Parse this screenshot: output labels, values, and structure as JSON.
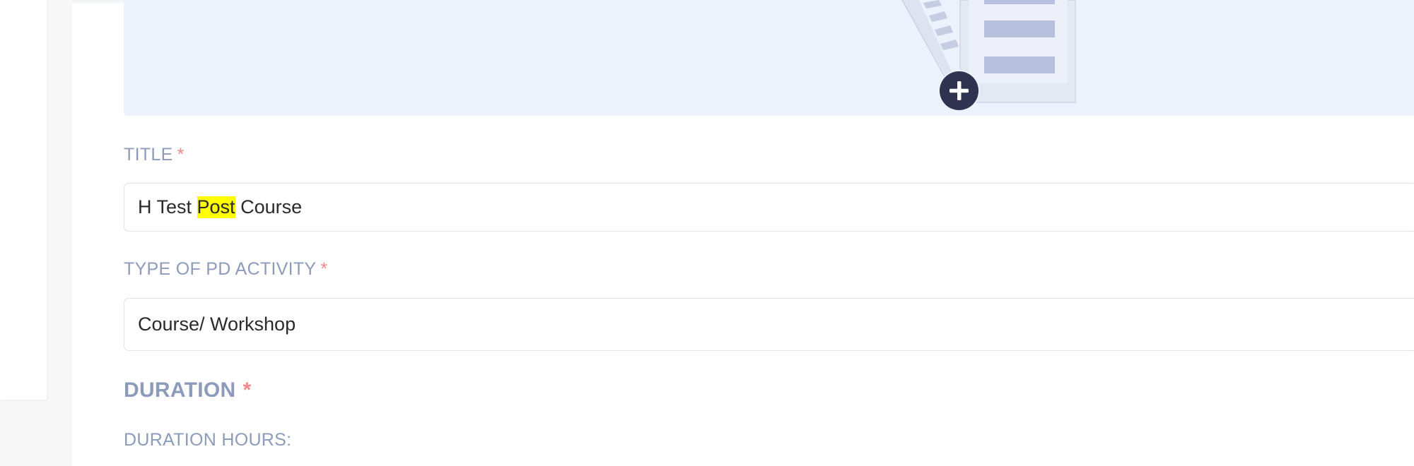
{
  "form": {
    "title_label": "TITLE",
    "title_required_mark": "*",
    "title_value_before": "H Test ",
    "title_value_highlight": "Post",
    "title_value_after": " Course",
    "type_label": "TYPE OF PD ACTIVITY",
    "type_required_mark": "*",
    "type_value": "Course/ Workshop",
    "duration_heading": "DURATION",
    "duration_required_mark": "*",
    "duration_hours_label": "DURATION HOURS:"
  },
  "upload": {
    "add_icon": "plus-circle-icon",
    "illustration_icon": "document-illustration"
  },
  "colors": {
    "label": "#8d9bbb",
    "required": "#ef8a8a",
    "upload_background": "#edf1fb",
    "add_button": "#2f3350",
    "search_highlight": "#ffff00"
  }
}
